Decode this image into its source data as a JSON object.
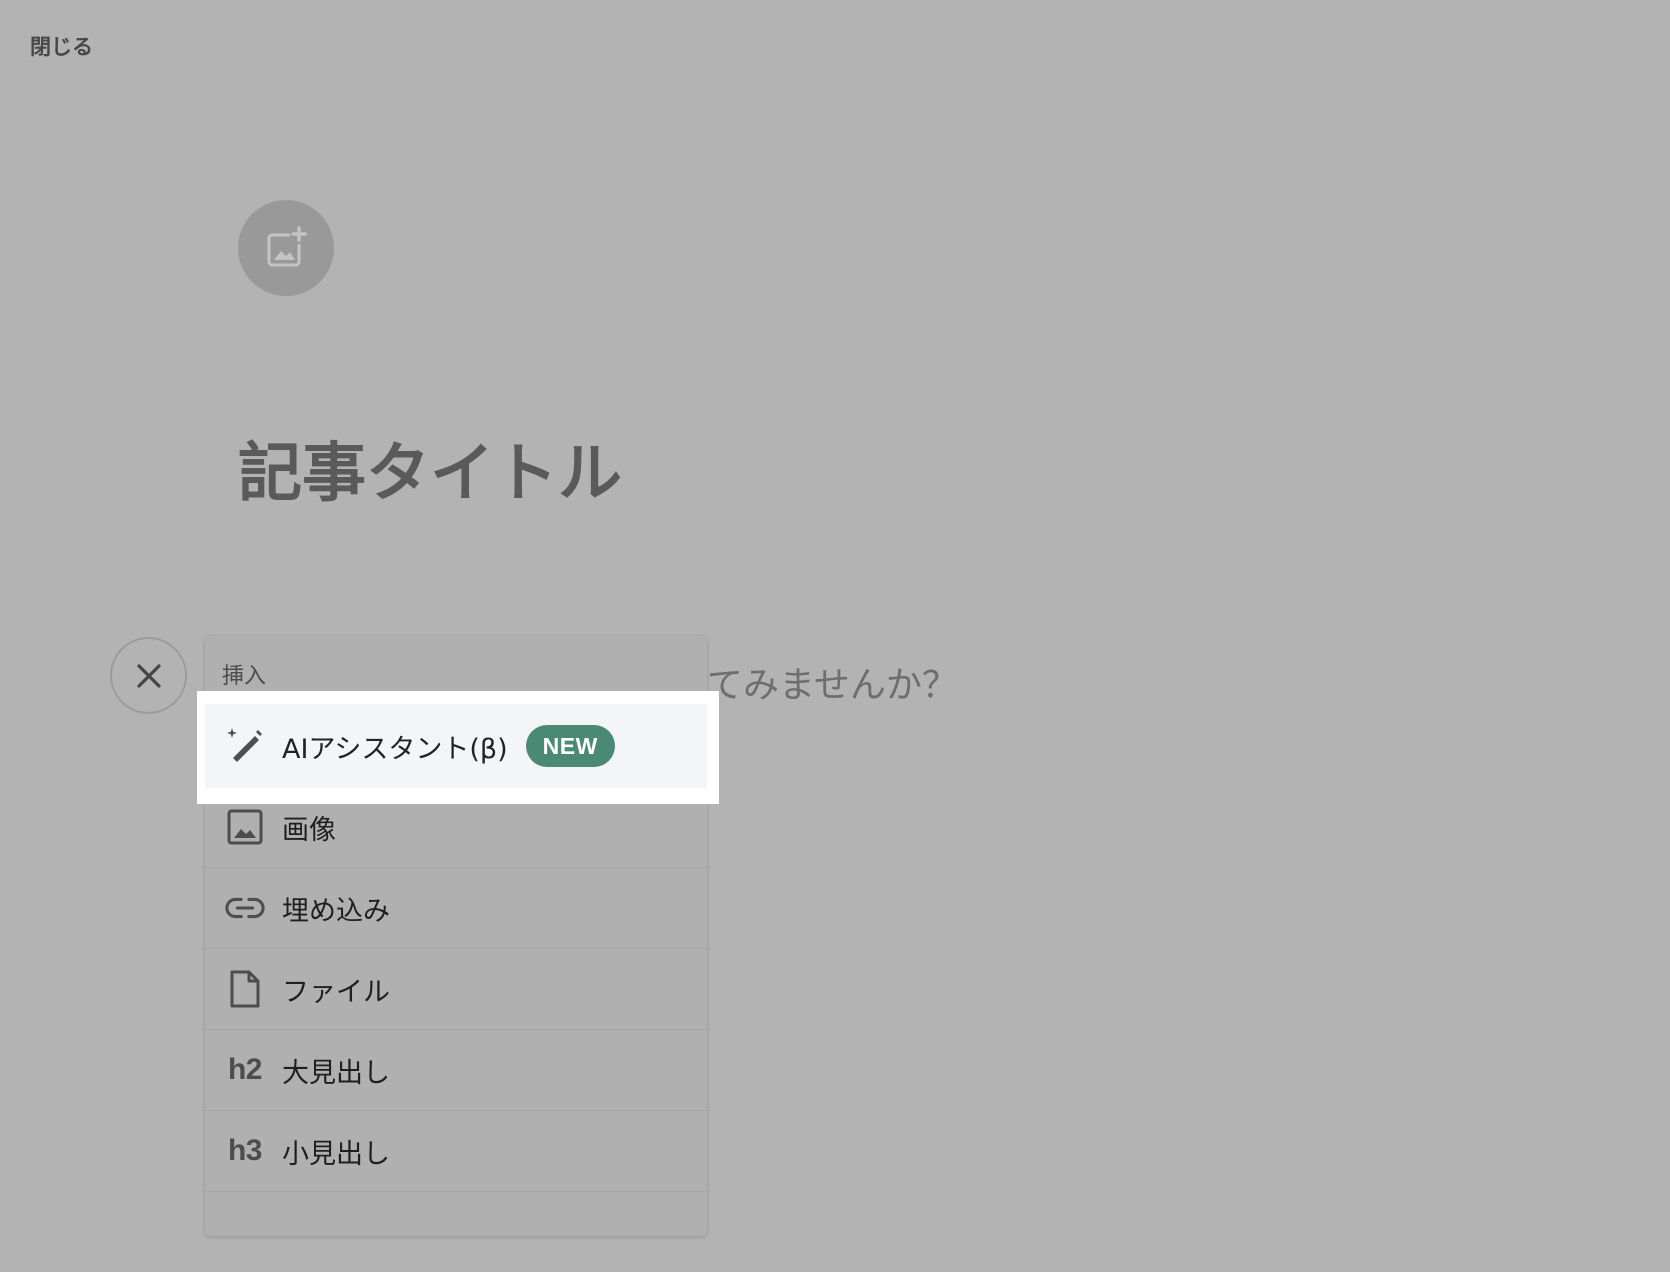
{
  "header": {
    "close_label": "閉じる"
  },
  "editor": {
    "title_placeholder": "記事タイトル",
    "body_placeholder_visible": "てみませんか？"
  },
  "insert_menu": {
    "header": "挿入",
    "ai_item": {
      "label": "AIアシスタント(β)",
      "badge": "NEW",
      "icon": "magic-wand-icon"
    },
    "items": [
      {
        "label": "画像",
        "icon": "image-icon"
      },
      {
        "label": "埋め込み",
        "icon": "link-icon"
      },
      {
        "label": "ファイル",
        "icon": "file-icon"
      },
      {
        "label": "大見出し",
        "icon": "h2-icon",
        "icon_text": "h2"
      },
      {
        "label": "小見出し",
        "icon": "h3-icon",
        "icon_text": "h3"
      }
    ]
  },
  "colors": {
    "overlay_background": "#b3b3b3",
    "highlight": "#ffffff",
    "badge_green": "#4a8a74"
  }
}
